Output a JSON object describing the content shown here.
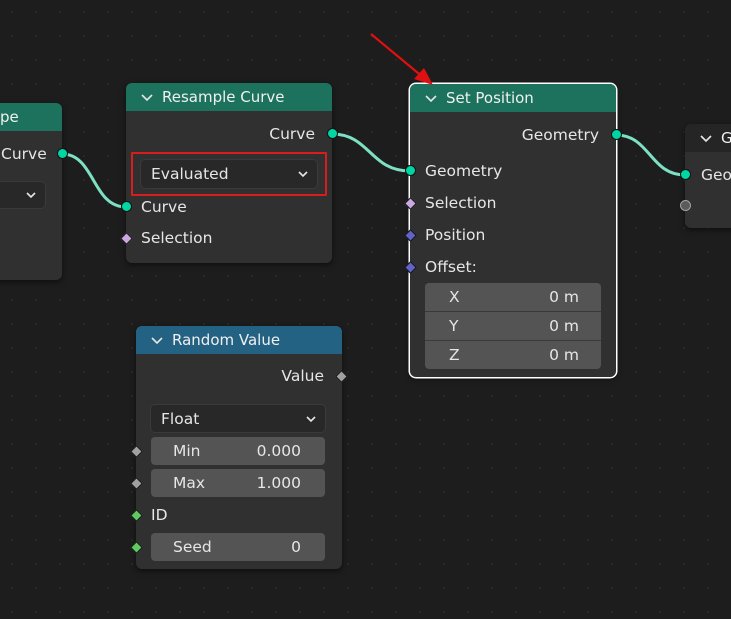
{
  "left_node": {
    "title": "pe",
    "output_curve": "Curve"
  },
  "resample_curve": {
    "title": "Resample Curve",
    "output_curve": "Curve",
    "mode": "Evaluated",
    "input_curve": "Curve",
    "input_selection": "Selection"
  },
  "set_position": {
    "title": "Set Position",
    "output_geometry": "Geometry",
    "input_geometry": "Geometry",
    "input_selection": "Selection",
    "input_position": "Position",
    "input_offset": "Offset:",
    "offset": [
      {
        "axis": "X",
        "value": "0 m"
      },
      {
        "axis": "Y",
        "value": "0 m"
      },
      {
        "axis": "Z",
        "value": "0 m"
      }
    ]
  },
  "right_node": {
    "title": "G",
    "input_geometry": "Geo"
  },
  "random_value": {
    "title": "Random Value",
    "output_value": "Value",
    "data_type": "Float",
    "min_label": "Min",
    "min_value": "0.000",
    "max_label": "Max",
    "max_value": "1.000",
    "id_label": "ID",
    "seed_label": "Seed",
    "seed_value": "0"
  },
  "colors": {
    "geometry_socket": "#00d6a3",
    "green_header": "#1d725e",
    "blue_header": "#246283",
    "highlight": "#d91c1c"
  }
}
